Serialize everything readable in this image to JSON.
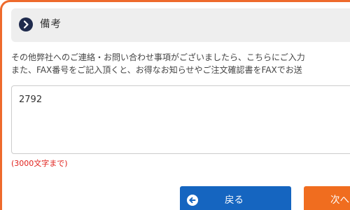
{
  "section": {
    "title": "備考"
  },
  "description": {
    "line1": "その他弊社へのご連絡・お問い合わせ事項がございましたら、こちらにご入力",
    "line2": "また、FAX番号をご記入頂くと、お得なお知らせやご注文確認書をFAXでお送"
  },
  "remarks_field": {
    "value": "2792"
  },
  "limit_note": "(3000文字まで)",
  "buttons": {
    "back_label": "戻る",
    "next_label": "次へ"
  },
  "colors": {
    "frame_border": "#ee6a2c",
    "header_bg": "#eeeeee",
    "header_icon": "#1f2b4d",
    "back_button": "#1565c0",
    "next_button": "#f06d1f",
    "limit_note": "#e0201b"
  },
  "icons": {
    "section_icon": "chevron-right-circle-icon",
    "back_icon": "arrow-left-circle-icon"
  }
}
